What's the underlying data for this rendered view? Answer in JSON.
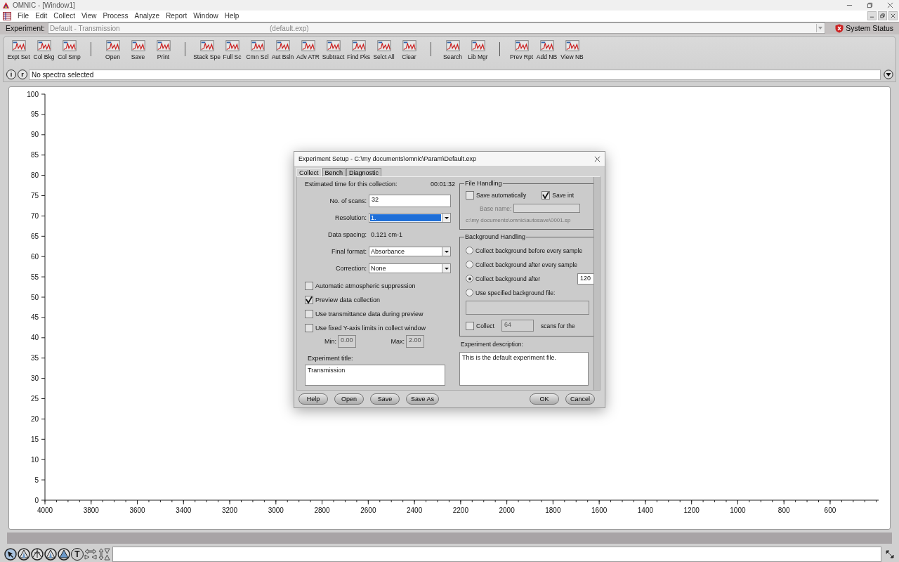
{
  "window": {
    "title": "OMNIC - [Window1]"
  },
  "menu": [
    "File",
    "Edit",
    "Collect",
    "View",
    "Process",
    "Analyze",
    "Report",
    "Window",
    "Help"
  ],
  "experiment_bar": {
    "label": "Experiment:",
    "value": "Default - Transmission",
    "file": "(default.exp)",
    "status_button": "System Status"
  },
  "toolbar": [
    {
      "label": "Expt Set",
      "separator_before": false
    },
    {
      "label": "Col Bkg",
      "separator_before": false
    },
    {
      "label": "Col Smp",
      "separator_before": false
    },
    {
      "label": "Open",
      "separator_before": true
    },
    {
      "label": "Save",
      "separator_before": false
    },
    {
      "label": "Print",
      "separator_before": false
    },
    {
      "label": "Stack Spe",
      "separator_before": true
    },
    {
      "label": "Full Sc",
      "separator_before": false
    },
    {
      "label": "Cmn Scl",
      "separator_before": false
    },
    {
      "label": "Aut Bsln",
      "separator_before": false
    },
    {
      "label": "Adv ATR",
      "separator_before": false
    },
    {
      "label": "Subtract",
      "separator_before": false
    },
    {
      "label": "Find Pks",
      "separator_before": false
    },
    {
      "label": "Selct All",
      "separator_before": false
    },
    {
      "label": "Clear",
      "separator_before": false
    },
    {
      "label": "Search",
      "separator_before": true
    },
    {
      "label": "Lib Mgr",
      "separator_before": false
    },
    {
      "label": "Prev Rpt",
      "separator_before": true
    },
    {
      "label": "Add NB",
      "separator_before": false
    },
    {
      "label": "View NB",
      "separator_before": false
    }
  ],
  "info_bar": {
    "buttons": [
      "i",
      "r"
    ],
    "text": "No spectra selected"
  },
  "chart": {
    "chart_data": {
      "type": "line",
      "xlim": [
        4000,
        390
      ],
      "ylim": [
        0,
        100
      ],
      "xticks": [
        4000,
        3800,
        3600,
        3400,
        3200,
        3000,
        2800,
        2600,
        2400,
        2200,
        2000,
        1800,
        1600,
        1400,
        1200,
        1000,
        800,
        600
      ],
      "yticks": [
        0,
        5,
        10,
        15,
        20,
        25,
        30,
        35,
        40,
        45,
        50,
        55,
        60,
        65,
        70,
        75,
        80,
        85,
        90,
        95,
        100
      ]
    }
  },
  "dialog": {
    "title": "Experiment Setup - C:\\my documents\\omnic\\Param\\Default.exp",
    "tabs": [
      {
        "label": "Collect",
        "selected": true
      },
      {
        "label": "Bench",
        "selected": false
      },
      {
        "label": "Diagnostic",
        "selected": false
      }
    ],
    "estimated_time": {
      "label": "Estimated time for this collection:",
      "value": "00:01:32"
    },
    "fields": [
      {
        "kind": "input",
        "label": "No. of scans:",
        "value": "32"
      },
      {
        "kind": "select",
        "label": "Resolution:",
        "value": "1.",
        "highlighted": true
      },
      {
        "kind": "text",
        "label": "Data spacing:",
        "value": "0.121 cm-1"
      },
      {
        "kind": "select",
        "label": "Final format:",
        "value": "Absorbance",
        "highlighted": false
      },
      {
        "kind": "select",
        "label": "Correction:",
        "value": "None",
        "highlighted": false
      }
    ],
    "options": [
      {
        "label": "Automatic atmospheric suppression",
        "checked": false
      },
      {
        "label": "Preview data collection",
        "checked": true
      },
      {
        "label": "Use transmittance data during preview",
        "checked": false
      },
      {
        "label": "Use fixed Y-axis limits in collect window",
        "checked": false
      }
    ],
    "limits": [
      {
        "label": "Min:",
        "value": "0.00"
      },
      {
        "label": "Max:",
        "value": "2.00"
      }
    ],
    "title_field": {
      "label": "Experiment title:",
      "value": "Transmission"
    },
    "file_handling": {
      "title": "File Handling",
      "checks": [
        {
          "label": "Save automatically",
          "checked": false
        },
        {
          "label": "Save int",
          "checked": true
        }
      ],
      "base_name": "Base name:",
      "path": "c:\\my documents\\omnic\\autosave\\0001.sp"
    },
    "background": {
      "title": "Background Handling",
      "options": [
        {
          "label": "Collect background before every sample",
          "selected": false
        },
        {
          "label": "Collect background after every sample",
          "selected": false
        },
        {
          "label": "Collect background after",
          "selected": true,
          "value": "120"
        },
        {
          "label": "Use specified background file:",
          "selected": false
        }
      ],
      "collect": {
        "label": "Collect",
        "checked": false,
        "value": "64",
        "suffix": "scans for the"
      }
    },
    "description": {
      "label": "Experiment description:",
      "value": "This is the default experiment file."
    },
    "buttons": [
      "Help",
      "Open",
      "Save",
      "Save As"
    ],
    "confirm_buttons": [
      "OK",
      "Cancel"
    ]
  },
  "bottom_tools": [
    {
      "kind": "pointer"
    },
    {
      "kind": "peak"
    },
    {
      "kind": "region"
    },
    {
      "kind": "peak"
    },
    {
      "kind": "peak_filled"
    },
    {
      "kind": "text",
      "label": "T"
    },
    {
      "kind": "expand_h"
    },
    {
      "kind": "expand_v"
    }
  ]
}
